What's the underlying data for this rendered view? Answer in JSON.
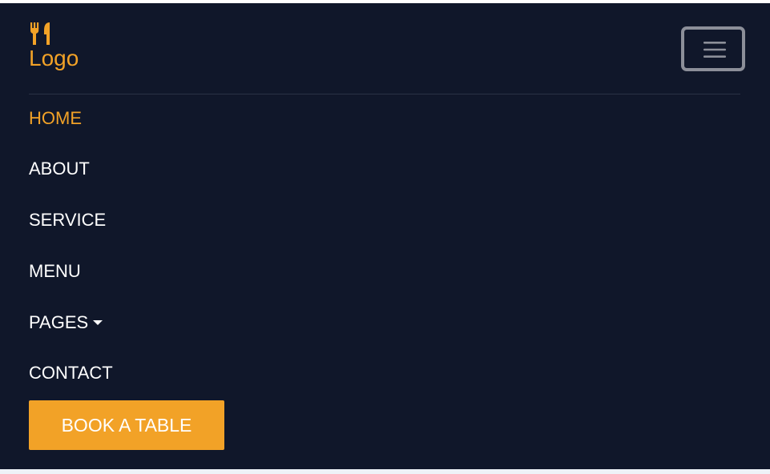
{
  "brand": {
    "icon": "fork-knife-icon",
    "text": "Logo",
    "color": "#f2a227"
  },
  "navbar": {
    "background": "#10172a",
    "toggler_icon": "hamburger-menu-icon"
  },
  "nav": {
    "items": [
      {
        "label": "HOME",
        "active": true
      },
      {
        "label": "ABOUT",
        "active": false
      },
      {
        "label": "SERVICE",
        "active": false
      },
      {
        "label": "MENU",
        "active": false
      },
      {
        "label": "PAGES",
        "active": false,
        "dropdown": true
      },
      {
        "label": "CONTACT",
        "active": false
      }
    ]
  },
  "cta": {
    "label": "BOOK A TABLE"
  }
}
